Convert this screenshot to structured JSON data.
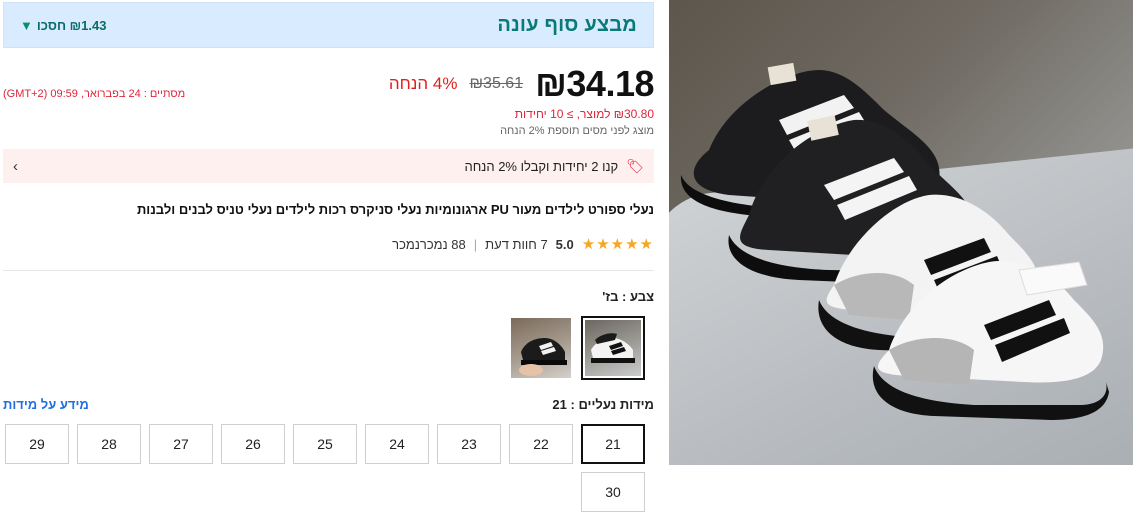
{
  "promo": {
    "title": "מבצע סוף עונה",
    "save_label": "₪1.43 חסכו"
  },
  "price": {
    "current": "₪34.18",
    "original": "₪35.61",
    "discount": "4% הנחה",
    "ends": "מסתיים : 24 בפברואר, 09:59 (GMT+2)",
    "bulk": "₪30.80 למוצר, ≥ 10 יחידות",
    "tax_note": "מוצג לפני מסים תוספת 2% הנחה"
  },
  "coupon": {
    "text": "קנו 2 יחידות וקבלו 2% הנחה"
  },
  "product": {
    "title": "נעלי ספורט לילדים מעור PU ארגונומיות נעלי סניקרס רכות לילדים נעלי טניס לבנים ולבנות"
  },
  "rating": {
    "score": "5.0",
    "stars_value": 5,
    "reviews": "7 חוות דעת",
    "sold": "88 נמכרנמכר"
  },
  "color": {
    "label": "צבע : בז'"
  },
  "sizes": {
    "label": "מידות נעליים : 21",
    "guide": "מידע על מידות",
    "options": [
      "21",
      "22",
      "23",
      "24",
      "25",
      "26",
      "27",
      "28",
      "29",
      "30"
    ],
    "selected": "21"
  },
  "colors": {
    "promo_bg": "#d9ecff",
    "promo_text": "#0a7a78",
    "accent_red": "#e0243a",
    "link_blue": "#1f6fe0",
    "star": "#f5a623"
  }
}
